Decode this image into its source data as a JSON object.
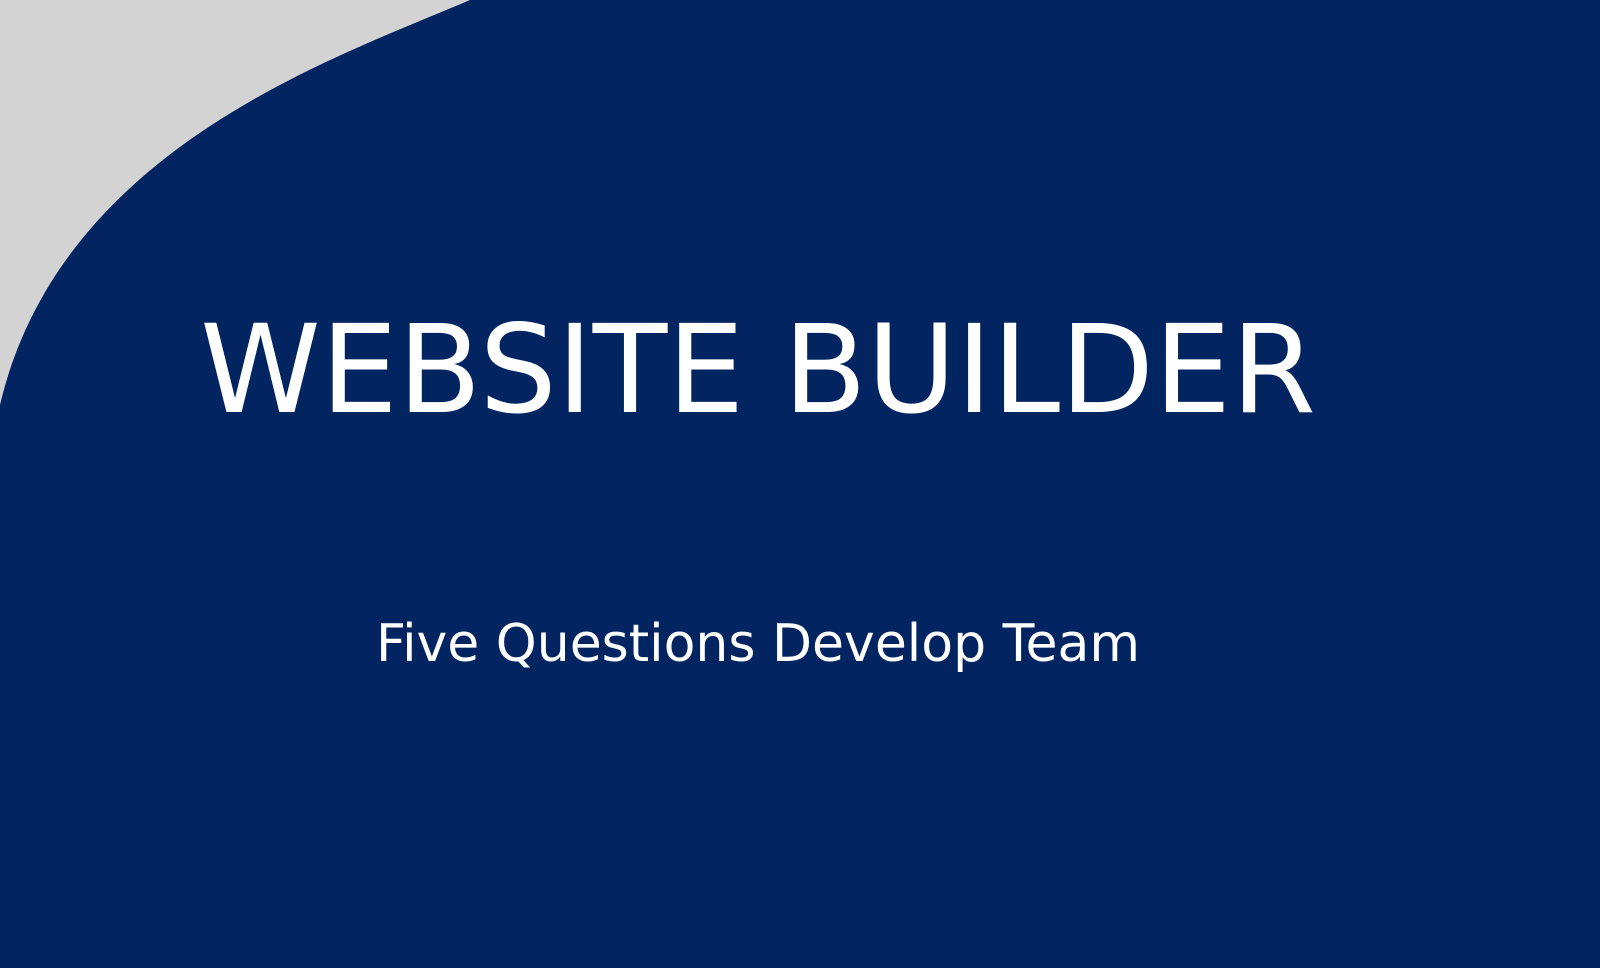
{
  "slide": {
    "title": "WEBSITE BUILDER",
    "subtitle": "Five Questions Develop Team"
  },
  "colors": {
    "background_gray": "#d3d3d3",
    "panel_navy": "#022562",
    "text": "#ffffff"
  }
}
